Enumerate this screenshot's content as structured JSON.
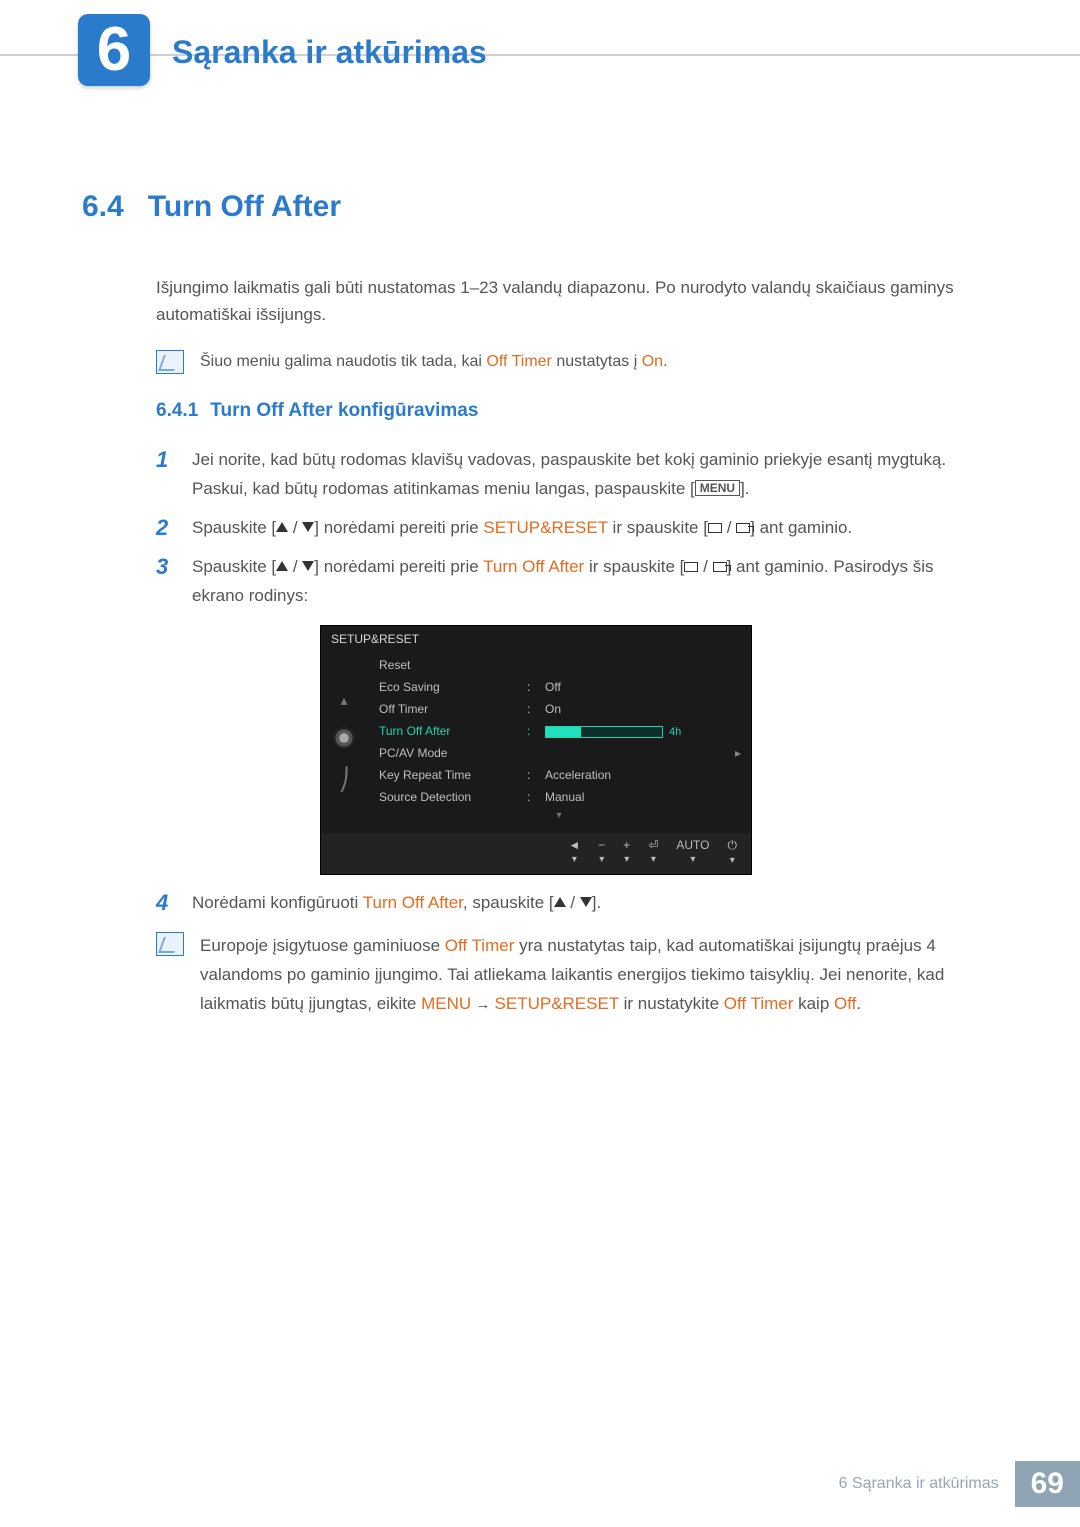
{
  "header": {
    "chapter_number": "6",
    "chapter_title": "Sąranka ir atkūrimas"
  },
  "section": {
    "number": "6.4",
    "title": "Turn Off After",
    "intro": "Išjungimo laikmatis gali būti nustatomas 1–23 valandų diapazonu. Po nurodyto valandų skaičiaus gaminys automatiškai išsijungs.",
    "precond_note": {
      "pre": "Šiuo meniu galima naudotis tik tada, kai ",
      "em1": "Off Timer",
      "mid": " nustatytas į ",
      "em2": "On",
      "post": "."
    }
  },
  "subsection": {
    "number": "6.4.1",
    "title": "Turn Off After konfigūravimas"
  },
  "steps": [
    {
      "n": "1",
      "text_a": "Jei norite, kad būtų rodomas klavišų vadovas, paspauskite bet kokį gaminio priekyje esantį mygtuką. Paskui, kad būtų rodomas atitinkamas meniu langas, paspauskite [",
      "menu": "MENU",
      "text_b": "]."
    },
    {
      "n": "2",
      "text_a": "Spauskite [",
      "text_b": "] norėdami pereiti prie ",
      "em": "SETUP&RESET",
      "text_c": " ir spauskite [",
      "text_d": "] ant gaminio."
    },
    {
      "n": "3",
      "text_a": "Spauskite [",
      "text_b": "] norėdami pereiti prie ",
      "em": "Turn Off After",
      "text_c": " ir spauskite [",
      "text_d": "] ant gaminio. Pasirodys šis ekrano rodinys:"
    },
    {
      "n": "4",
      "text_a": "Norėdami konfigūruoti ",
      "em": "Turn Off After",
      "text_b": ", spauskite [",
      "text_c": "]."
    }
  ],
  "osd": {
    "title": "SETUP&RESET",
    "rows": [
      {
        "label": "Reset",
        "value": ""
      },
      {
        "label": "Eco Saving",
        "value": "Off"
      },
      {
        "label": "Off Timer",
        "value": "On"
      },
      {
        "label": "Turn Off After",
        "value": "4h",
        "selected": true,
        "slider": true
      },
      {
        "label": "PC/AV Mode",
        "value": "",
        "arrow": true
      },
      {
        "label": "Key Repeat Time",
        "value": "Acceleration"
      },
      {
        "label": "Source Detection",
        "value": "Manual"
      }
    ],
    "footer": [
      "◄",
      "−",
      "+",
      "⏎",
      "AUTO",
      "⏻"
    ]
  },
  "eu_note": {
    "t1": "Europoje įsigytuose gaminiuose ",
    "em1": "Off Timer",
    "t2": " yra nustatytas taip, kad automatiškai įsijungtų praėjus 4 valandoms po gaminio įjungimo. Tai atliekama laikantis energijos tiekimo taisyklių. Jei nenorite, kad laikmatis būtų įjungtas, eikite ",
    "em2": "MENU",
    "arrow": " → ",
    "em3": "SETUP&RESET",
    "t3": " ir nustatykite ",
    "em4": "Off Timer",
    "t4": " kaip ",
    "em5": "Off",
    "t5": "."
  },
  "footer": {
    "text": "6 Sąranka ir atkūrimas",
    "page": "69"
  }
}
